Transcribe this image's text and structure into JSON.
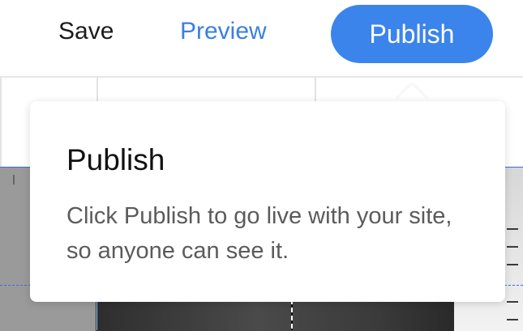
{
  "toolbar": {
    "save_label": "Save",
    "preview_label": "Preview",
    "publish_label": "Publish"
  },
  "tooltip": {
    "title": "Publish",
    "body": "Click Publish to go live with your site, so anyone can see it."
  },
  "colors": {
    "accent": "#3b84ec",
    "link": "#3a7fe0",
    "guide": "#3d6ad8"
  }
}
